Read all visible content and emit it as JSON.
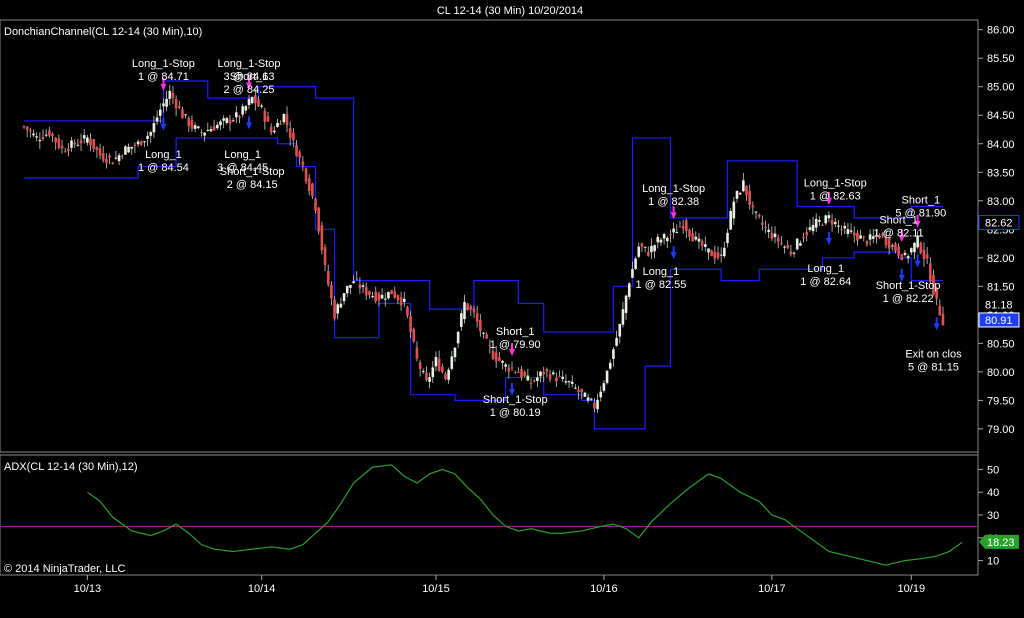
{
  "window_title": "CL 12-14 (30 Min)  10/20/2014",
  "copyright": "© 2014 NinjaTrader, LLC",
  "colors": {
    "background": "#000000",
    "channel": "#1c1cff",
    "adx": "#2aa02a",
    "adx_threshold": "#aa22aa",
    "candle_up": "#e8f0e0",
    "candle_down": "#e05050",
    "long_marker": "#1c3cff",
    "short_marker": "#ff33dd",
    "price_box_blue": "#1c3cff",
    "adx_box": "#2aa02a"
  },
  "chart_data": [
    {
      "type": "candlestick",
      "title": "DonchianChannel(CL 12-14 (30 Min),10)",
      "ylim": [
        78.7,
        86.1
      ],
      "yticks": [
        "86.00",
        "85.50",
        "85.00",
        "84.50",
        "84.00",
        "83.50",
        "83.00",
        "82.50",
        "82.00",
        "81.50",
        "81.00",
        "80.50",
        "80.00",
        "79.50",
        "79.00"
      ],
      "xticks": [
        "10/13",
        "10/14",
        "10/15",
        "10/16",
        "10/17",
        "10/19"
      ],
      "price_boxes": [
        {
          "label": "82.62",
          "style": "outline"
        },
        {
          "label": "81.18",
          "style": "plain"
        },
        {
          "label": "80.91",
          "style": "filled"
        }
      ],
      "close_path": [
        [
          0,
          84.3
        ],
        [
          4,
          84.1
        ],
        [
          8,
          84.2
        ],
        [
          12,
          83.9
        ],
        [
          16,
          84.0
        ],
        [
          20,
          84.1
        ],
        [
          24,
          83.8
        ],
        [
          28,
          83.7
        ],
        [
          32,
          83.9
        ],
        [
          36,
          84.0
        ],
        [
          40,
          84.2
        ],
        [
          43,
          84.6
        ],
        [
          46,
          84.9
        ],
        [
          50,
          84.5
        ],
        [
          53,
          84.3
        ],
        [
          56,
          84.2
        ],
        [
          60,
          84.3
        ],
        [
          64,
          84.4
        ],
        [
          68,
          84.5
        ],
        [
          72,
          84.8
        ],
        [
          75,
          84.6
        ],
        [
          78,
          84.2
        ],
        [
          82,
          84.5
        ],
        [
          85,
          84.0
        ],
        [
          88,
          83.6
        ],
        [
          92,
          82.9
        ],
        [
          95,
          81.8
        ],
        [
          98,
          81.0
        ],
        [
          101,
          81.4
        ],
        [
          104,
          81.6
        ],
        [
          108,
          81.4
        ],
        [
          112,
          81.3
        ],
        [
          116,
          81.4
        ],
        [
          120,
          81.2
        ],
        [
          124,
          80.2
        ],
        [
          127,
          79.8
        ],
        [
          130,
          80.2
        ],
        [
          133,
          79.9
        ],
        [
          136,
          80.5
        ],
        [
          139,
          81.2
        ],
        [
          142,
          81.0
        ],
        [
          145,
          80.6
        ],
        [
          148,
          80.3
        ],
        [
          152,
          80.1
        ],
        [
          156,
          80.0
        ],
        [
          160,
          79.8
        ],
        [
          164,
          80.0
        ],
        [
          168,
          79.9
        ],
        [
          172,
          79.8
        ],
        [
          176,
          79.6
        ],
        [
          180,
          79.4
        ],
        [
          184,
          80.0
        ],
        [
          188,
          80.8
        ],
        [
          191,
          81.6
        ],
        [
          194,
          82.2
        ],
        [
          197,
          82.1
        ],
        [
          200,
          82.3
        ],
        [
          204,
          82.4
        ],
        [
          208,
          82.6
        ],
        [
          212,
          82.3
        ],
        [
          216,
          82.1
        ],
        [
          220,
          82.0
        ],
        [
          224,
          83.0
        ],
        [
          227,
          83.3
        ],
        [
          230,
          82.8
        ],
        [
          234,
          82.5
        ],
        [
          238,
          82.3
        ],
        [
          242,
          82.1
        ],
        [
          246,
          82.4
        ],
        [
          250,
          82.6
        ],
        [
          254,
          82.7
        ],
        [
          258,
          82.5
        ],
        [
          262,
          82.4
        ],
        [
          266,
          82.3
        ],
        [
          270,
          82.4
        ],
        [
          274,
          82.2
        ],
        [
          278,
          82.0
        ],
        [
          282,
          82.3
        ],
        [
          285,
          81.9
        ],
        [
          288,
          81.2
        ],
        [
          290,
          80.9
        ]
      ],
      "upper_channel": [
        [
          0,
          84.4
        ],
        [
          28,
          84.4
        ],
        [
          38,
          84.4
        ],
        [
          44,
          85.1
        ],
        [
          52,
          85.1
        ],
        [
          58,
          84.8
        ],
        [
          70,
          84.8
        ],
        [
          74,
          85.0
        ],
        [
          86,
          85.0
        ],
        [
          92,
          84.8
        ],
        [
          100,
          84.8
        ],
        [
          104,
          81.6
        ],
        [
          124,
          81.6
        ],
        [
          128,
          81.1
        ],
        [
          138,
          81.1
        ],
        [
          142,
          81.6
        ],
        [
          150,
          81.6
        ],
        [
          156,
          81.2
        ],
        [
          164,
          80.7
        ],
        [
          180,
          80.7
        ],
        [
          186,
          81.5
        ],
        [
          192,
          84.1
        ],
        [
          200,
          84.1
        ],
        [
          204,
          82.7
        ],
        [
          214,
          82.7
        ],
        [
          222,
          83.7
        ],
        [
          236,
          83.7
        ],
        [
          244,
          82.9
        ],
        [
          262,
          82.7
        ],
        [
          276,
          82.7
        ],
        [
          280,
          82.9
        ],
        [
          290,
          82.9
        ]
      ],
      "lower_channel": [
        [
          0,
          83.4
        ],
        [
          30,
          83.4
        ],
        [
          36,
          83.6
        ],
        [
          44,
          83.6
        ],
        [
          48,
          84.1
        ],
        [
          60,
          84.1
        ],
        [
          70,
          84.1
        ],
        [
          80,
          84.0
        ],
        [
          86,
          83.6
        ],
        [
          92,
          82.5
        ],
        [
          98,
          80.6
        ],
        [
          108,
          80.6
        ],
        [
          112,
          81.2
        ],
        [
          118,
          81.2
        ],
        [
          122,
          79.6
        ],
        [
          132,
          79.6
        ],
        [
          136,
          79.5
        ],
        [
          146,
          79.5
        ],
        [
          152,
          79.9
        ],
        [
          164,
          79.6
        ],
        [
          176,
          79.5
        ],
        [
          180,
          79.0
        ],
        [
          190,
          79.0
        ],
        [
          196,
          80.1
        ],
        [
          204,
          81.8
        ],
        [
          214,
          81.8
        ],
        [
          220,
          81.6
        ],
        [
          228,
          81.6
        ],
        [
          232,
          81.8
        ],
        [
          244,
          81.8
        ],
        [
          252,
          82.0
        ],
        [
          262,
          82.1
        ],
        [
          276,
          82.0
        ],
        [
          280,
          81.6
        ],
        [
          290,
          81.6
        ]
      ],
      "markers": [
        {
          "x": 44,
          "type": "short"
        },
        {
          "x": 44,
          "type": "long"
        },
        {
          "x": 71,
          "type": "short"
        },
        {
          "x": 71,
          "type": "long"
        },
        {
          "x": 154,
          "type": "short"
        },
        {
          "x": 154,
          "type": "long"
        },
        {
          "x": 205,
          "type": "short"
        },
        {
          "x": 205,
          "type": "long"
        },
        {
          "x": 254,
          "type": "short"
        },
        {
          "x": 254,
          "type": "long"
        },
        {
          "x": 277,
          "type": "short"
        },
        {
          "x": 277,
          "type": "long"
        },
        {
          "x": 282,
          "type": "short"
        },
        {
          "x": 282,
          "type": "long"
        },
        {
          "x": 288,
          "type": "long"
        }
      ],
      "annotations": [
        {
          "lines": [
            "Long_1-Stop",
            "1 @ 84.71"
          ],
          "x": 44,
          "y": 85.35
        },
        {
          "lines": [
            "Long_1-Stop",
            "3 @ 84.63"
          ],
          "x": 71,
          "y": 85.35
        },
        {
          "lines": [
            "Short_1",
            "2 @ 84.25"
          ],
          "x": 71,
          "y": 85.12
        },
        {
          "lines": [
            "Long_1",
            "1 @ 84.54"
          ],
          "x": 44,
          "y": 83.75
        },
        {
          "lines": [
            "Long_1",
            "3 @ 84.45"
          ],
          "x": 69,
          "y": 83.75
        },
        {
          "lines": [
            "Short_1-Stop",
            "2 @ 84.15"
          ],
          "x": 72,
          "y": 83.45
        },
        {
          "lines": [
            "Long_1-Stop",
            "1 @ 82.38"
          ],
          "x": 205,
          "y": 83.15
        },
        {
          "lines": [
            "Long_1",
            "1 @ 82.55"
          ],
          "x": 201,
          "y": 81.7
        },
        {
          "lines": [
            "Long_1-Stop",
            "1 @ 82.63"
          ],
          "x": 256,
          "y": 83.25
        },
        {
          "lines": [
            "Long_1",
            "1 @ 82.64"
          ],
          "x": 253,
          "y": 81.75
        },
        {
          "lines": [
            "Short_1",
            "5 @ 81.90"
          ],
          "x": 283,
          "y": 82.95
        },
        {
          "lines": [
            "Short_1",
            "1 @ 82.11"
          ],
          "x": 276,
          "y": 82.6
        },
        {
          "lines": [
            "Short_1-Stop",
            "1 @ 82.22"
          ],
          "x": 279,
          "y": 81.45
        },
        {
          "lines": [
            "Short_1",
            "1 @ 79.90"
          ],
          "x": 155,
          "y": 80.65
        },
        {
          "lines": [
            "Short_1-Stop",
            "1 @ 80.19"
          ],
          "x": 155,
          "y": 79.45
        },
        {
          "lines": [
            "Exit on clos",
            "5 @ 81.15"
          ],
          "x": 287,
          "y": 80.25
        }
      ]
    },
    {
      "type": "line",
      "title": "ADX(CL 12-14 (30 Min),12)",
      "ylim": [
        5,
        55
      ],
      "yticks": [
        "50",
        "40",
        "30",
        "20",
        "10"
      ],
      "threshold": 25,
      "last_value_label": "18.23",
      "series": [
        {
          "values": [
            [
              20,
              40
            ],
            [
              24,
              36
            ],
            [
              28,
              29
            ],
            [
              34,
              23
            ],
            [
              40,
              21
            ],
            [
              44,
              23
            ],
            [
              48,
              26
            ],
            [
              52,
              22
            ],
            [
              56,
              17
            ],
            [
              60,
              15
            ],
            [
              66,
              14
            ],
            [
              72,
              15
            ],
            [
              78,
              16
            ],
            [
              84,
              15
            ],
            [
              88,
              17
            ],
            [
              92,
              22
            ],
            [
              96,
              27
            ],
            [
              100,
              35
            ],
            [
              104,
              44
            ],
            [
              110,
              51
            ],
            [
              116,
              52
            ],
            [
              120,
              47
            ],
            [
              124,
              44
            ],
            [
              128,
              48
            ],
            [
              132,
              50
            ],
            [
              136,
              48
            ],
            [
              140,
              42
            ],
            [
              144,
              37
            ],
            [
              148,
              30
            ],
            [
              152,
              25
            ],
            [
              156,
              23
            ],
            [
              160,
              24
            ],
            [
              166,
              22
            ],
            [
              170,
              22
            ],
            [
              176,
              23
            ],
            [
              182,
              25
            ],
            [
              186,
              26
            ],
            [
              190,
              24
            ],
            [
              194,
              20
            ],
            [
              198,
              27
            ],
            [
              204,
              35
            ],
            [
              210,
              42
            ],
            [
              216,
              48
            ],
            [
              220,
              46
            ],
            [
              226,
              40
            ],
            [
              232,
              36
            ],
            [
              236,
              30
            ],
            [
              240,
              28
            ],
            [
              244,
              24
            ],
            [
              248,
              20
            ],
            [
              254,
              14
            ],
            [
              260,
              12
            ],
            [
              266,
              10
            ],
            [
              272,
              8
            ],
            [
              278,
              10
            ],
            [
              284,
              11
            ],
            [
              288,
              12
            ],
            [
              292,
              14
            ],
            [
              296,
              18
            ]
          ]
        }
      ]
    }
  ]
}
